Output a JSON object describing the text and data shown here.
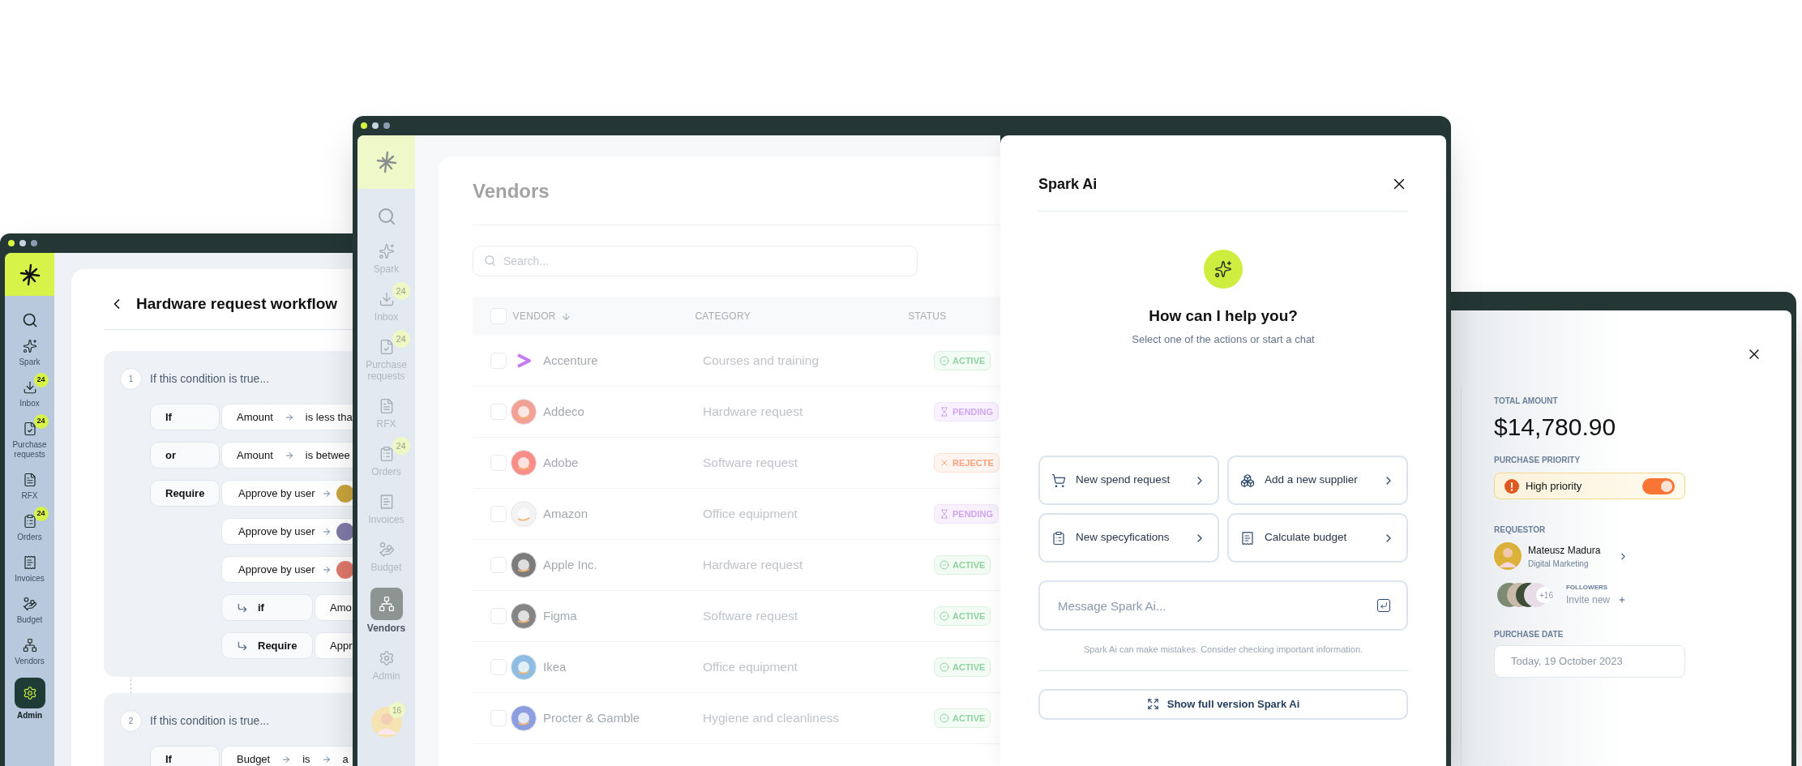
{
  "workflow_window": {
    "sidebar": {
      "items": [
        {
          "label": "Spark",
          "selected": false
        },
        {
          "label": "Inbox",
          "badge": "24",
          "selected": false
        },
        {
          "label": "Purchase requests",
          "badge": "24",
          "selected": false
        },
        {
          "label": "RFX",
          "selected": false
        },
        {
          "label": "Orders",
          "badge": "24",
          "selected": false
        },
        {
          "label": "Invoices",
          "selected": false
        },
        {
          "label": "Budget",
          "selected": false
        },
        {
          "label": "Vendors",
          "selected": false
        },
        {
          "label": "Admin",
          "selected": true
        }
      ]
    },
    "title": "Hardware request workflow",
    "conditions": [
      {
        "number": "1",
        "heading": "If this condition is true...",
        "rows": [
          {
            "kind": "rule",
            "operator": "If",
            "parts": [
              "Amount",
              "is less tha"
            ]
          },
          {
            "kind": "rule",
            "operator": "or",
            "parts": [
              "Amount",
              "is betwee"
            ]
          },
          {
            "kind": "approval",
            "operator": "Require",
            "text": "Approve by user",
            "color": "#c9a43c"
          },
          {
            "kind": "approval",
            "text": "Approve by user",
            "color": "#7f7ba8"
          },
          {
            "kind": "approval",
            "text": "Approve by user",
            "color": "#e0786a"
          },
          {
            "kind": "branch",
            "label": "if",
            "value": "Amo"
          },
          {
            "kind": "branch",
            "label": "Require",
            "value": "Appr"
          }
        ]
      },
      {
        "number": "2",
        "heading": "If this condition is true...",
        "rows": [
          {
            "kind": "rule",
            "operator": "If",
            "parts": [
              "Budget",
              "is",
              "a"
            ]
          }
        ]
      }
    ]
  },
  "vendors_window": {
    "sidebar": {
      "items": [
        {
          "label": "Spark",
          "selected": false
        },
        {
          "label": "Inbox",
          "badge": "24",
          "selected": false
        },
        {
          "label": "Purchase requests",
          "badge": "24",
          "selected": false
        },
        {
          "label": "RFX",
          "selected": false
        },
        {
          "label": "Orders",
          "badge": "24",
          "selected": false
        },
        {
          "label": "Invoices",
          "selected": false
        },
        {
          "label": "Budget",
          "selected": false
        },
        {
          "label": "Vendors",
          "selected": true
        },
        {
          "label": "Admin",
          "selected": false
        }
      ],
      "user_badge": "16"
    },
    "title": "Vendors",
    "search": {
      "placeholder": "Search..."
    },
    "table": {
      "all_checked": false,
      "columns": [
        {
          "label": "VENDOR",
          "sorted": true
        },
        {
          "label": "CATEGORY",
          "sorted": false
        },
        {
          "label": "STATUS",
          "sorted": false
        }
      ],
      "rows": [
        {
          "checked": false,
          "name": "Accenture",
          "color": "#c57cf0",
          "category": "Courses and training",
          "status": {
            "kind": "active",
            "label": "ACTIVE"
          }
        },
        {
          "checked": false,
          "name": "Addeco",
          "color": "#f2a196",
          "category": "Hardware request",
          "status": {
            "kind": "pending",
            "label": "PENDING"
          }
        },
        {
          "checked": false,
          "name": "Adobe",
          "color": "#f98d88",
          "category": "Software request",
          "status": {
            "kind": "rejected",
            "label": "REJECTE"
          }
        },
        {
          "checked": false,
          "name": "Amazon",
          "color": "#f3f3f3",
          "category": "Office equipment",
          "status": {
            "kind": "pending",
            "label": "PENDING"
          }
        },
        {
          "checked": false,
          "name": "Apple Inc.",
          "color": "#7c7c7c",
          "category": "Hardware request",
          "status": {
            "kind": "active",
            "label": "ACTIVE"
          }
        },
        {
          "checked": false,
          "name": "Figma",
          "color": "#858585",
          "category": "Software request",
          "status": {
            "kind": "active",
            "label": "ACTIVE"
          }
        },
        {
          "checked": false,
          "name": "Ikea",
          "color": "#8dbde3",
          "category": "Office equipment",
          "status": {
            "kind": "active",
            "label": "ACTIVE"
          }
        },
        {
          "checked": false,
          "name": "Procter & Gamble",
          "color": "#8c9ee0",
          "category": "Hygiene and cleanliness",
          "status": {
            "kind": "active",
            "label": "ACTIVE"
          }
        }
      ]
    }
  },
  "spark_panel": {
    "title": "Spark Ai",
    "heading": "How can I help you?",
    "subtitle": "Select one of the actions or start a chat",
    "actions": [
      "New spend request",
      "Add a new supplier",
      "New specyfications",
      "Calculate budget"
    ],
    "message": {
      "placeholder": "Message Spark Ai..."
    },
    "disclaimer": "Spark Ai can make mistakes. Consider checking important information.",
    "full_version_button": "Show full version Spark Ai"
  },
  "purchase_window": {
    "total_label": "TOTAL AMOUNT",
    "total": "$14,780.90",
    "priority_label": "PURCHASE PRIORITY",
    "priority": {
      "label": "High priority",
      "on": true
    },
    "requestor_label": "REQUESTOR",
    "requestor": {
      "name": "Mateusz Madura",
      "role": "Digital Marketing"
    },
    "followers": {
      "count": "+16",
      "label": "FOLLOWERS",
      "invite": "Invite new"
    },
    "date_label": "PURCHASE DATE",
    "date": "Today, 19 October 2023"
  }
}
